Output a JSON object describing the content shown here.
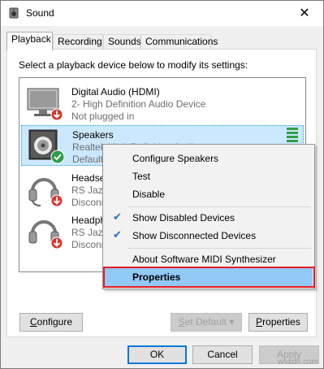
{
  "window": {
    "title": "Sound",
    "close_glyph": "✕"
  },
  "tabs": [
    {
      "label": "Playback",
      "active": true
    },
    {
      "label": "Recording",
      "active": false
    },
    {
      "label": "Sounds",
      "active": false
    },
    {
      "label": "Communications",
      "active": false
    }
  ],
  "instruction": "Select a playback device below to modify its settings:",
  "devices": [
    {
      "name": "Digital Audio (HDMI)",
      "desc": "2- High Definition Audio Device",
      "status": "Not plugged in",
      "icon": "monitor-icon",
      "badge": "red-down-arrow"
    },
    {
      "name": "Speakers",
      "desc": "Realtek High Definition Audio",
      "status": "Default",
      "icon": "speaker-icon",
      "badge": "green-check"
    },
    {
      "name": "Headset",
      "desc": "RS Jazz",
      "status": "Disconne",
      "icon": "headset-icon",
      "badge": "red-down-arrow"
    },
    {
      "name": "Headpho",
      "desc": "RS Jazz",
      "status": "Disconne",
      "icon": "headset-icon",
      "badge": "red-down-arrow"
    }
  ],
  "context_menu": {
    "items": [
      {
        "label": "Configure Speakers",
        "checked": false
      },
      {
        "label": "Test",
        "checked": false
      },
      {
        "label": "Disable",
        "checked": false
      },
      {
        "label": "Show Disabled Devices",
        "checked": true
      },
      {
        "label": "Show Disconnected Devices",
        "checked": true
      },
      {
        "label": "About Software MIDI Synthesizer",
        "checked": false
      },
      {
        "label": "Properties",
        "checked": false,
        "highlighted": true
      }
    ],
    "check_glyph": "✔"
  },
  "buttons": {
    "configure_u": "C",
    "configure_rest": "onfigure",
    "set_default_u": "S",
    "set_default_rest": "et Default",
    "properties_u": "P",
    "properties_rest": "roperties",
    "ok": "OK",
    "cancel": "Cancel",
    "apply": "Apply"
  },
  "watermark": "wsxdn.com",
  "colors": {
    "selection": "#cce8ff",
    "highlight": "#91c9f7",
    "annotation_red": "#e51c23",
    "meter_green": "#2ea043"
  }
}
